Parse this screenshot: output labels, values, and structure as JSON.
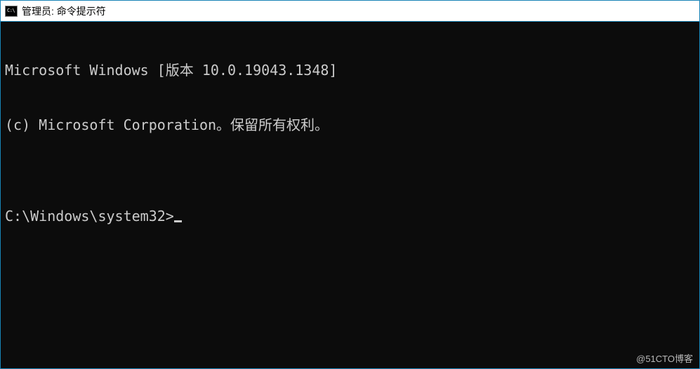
{
  "titlebar": {
    "icon_label": "C:\\",
    "title": "管理员: 命令提示符"
  },
  "terminal": {
    "line1": "Microsoft Windows [版本 10.0.19043.1348]",
    "line2": "(c) Microsoft Corporation。保留所有权利。",
    "blank": "",
    "prompt": "C:\\Windows\\system32>"
  },
  "watermark": "@51CTO博客"
}
